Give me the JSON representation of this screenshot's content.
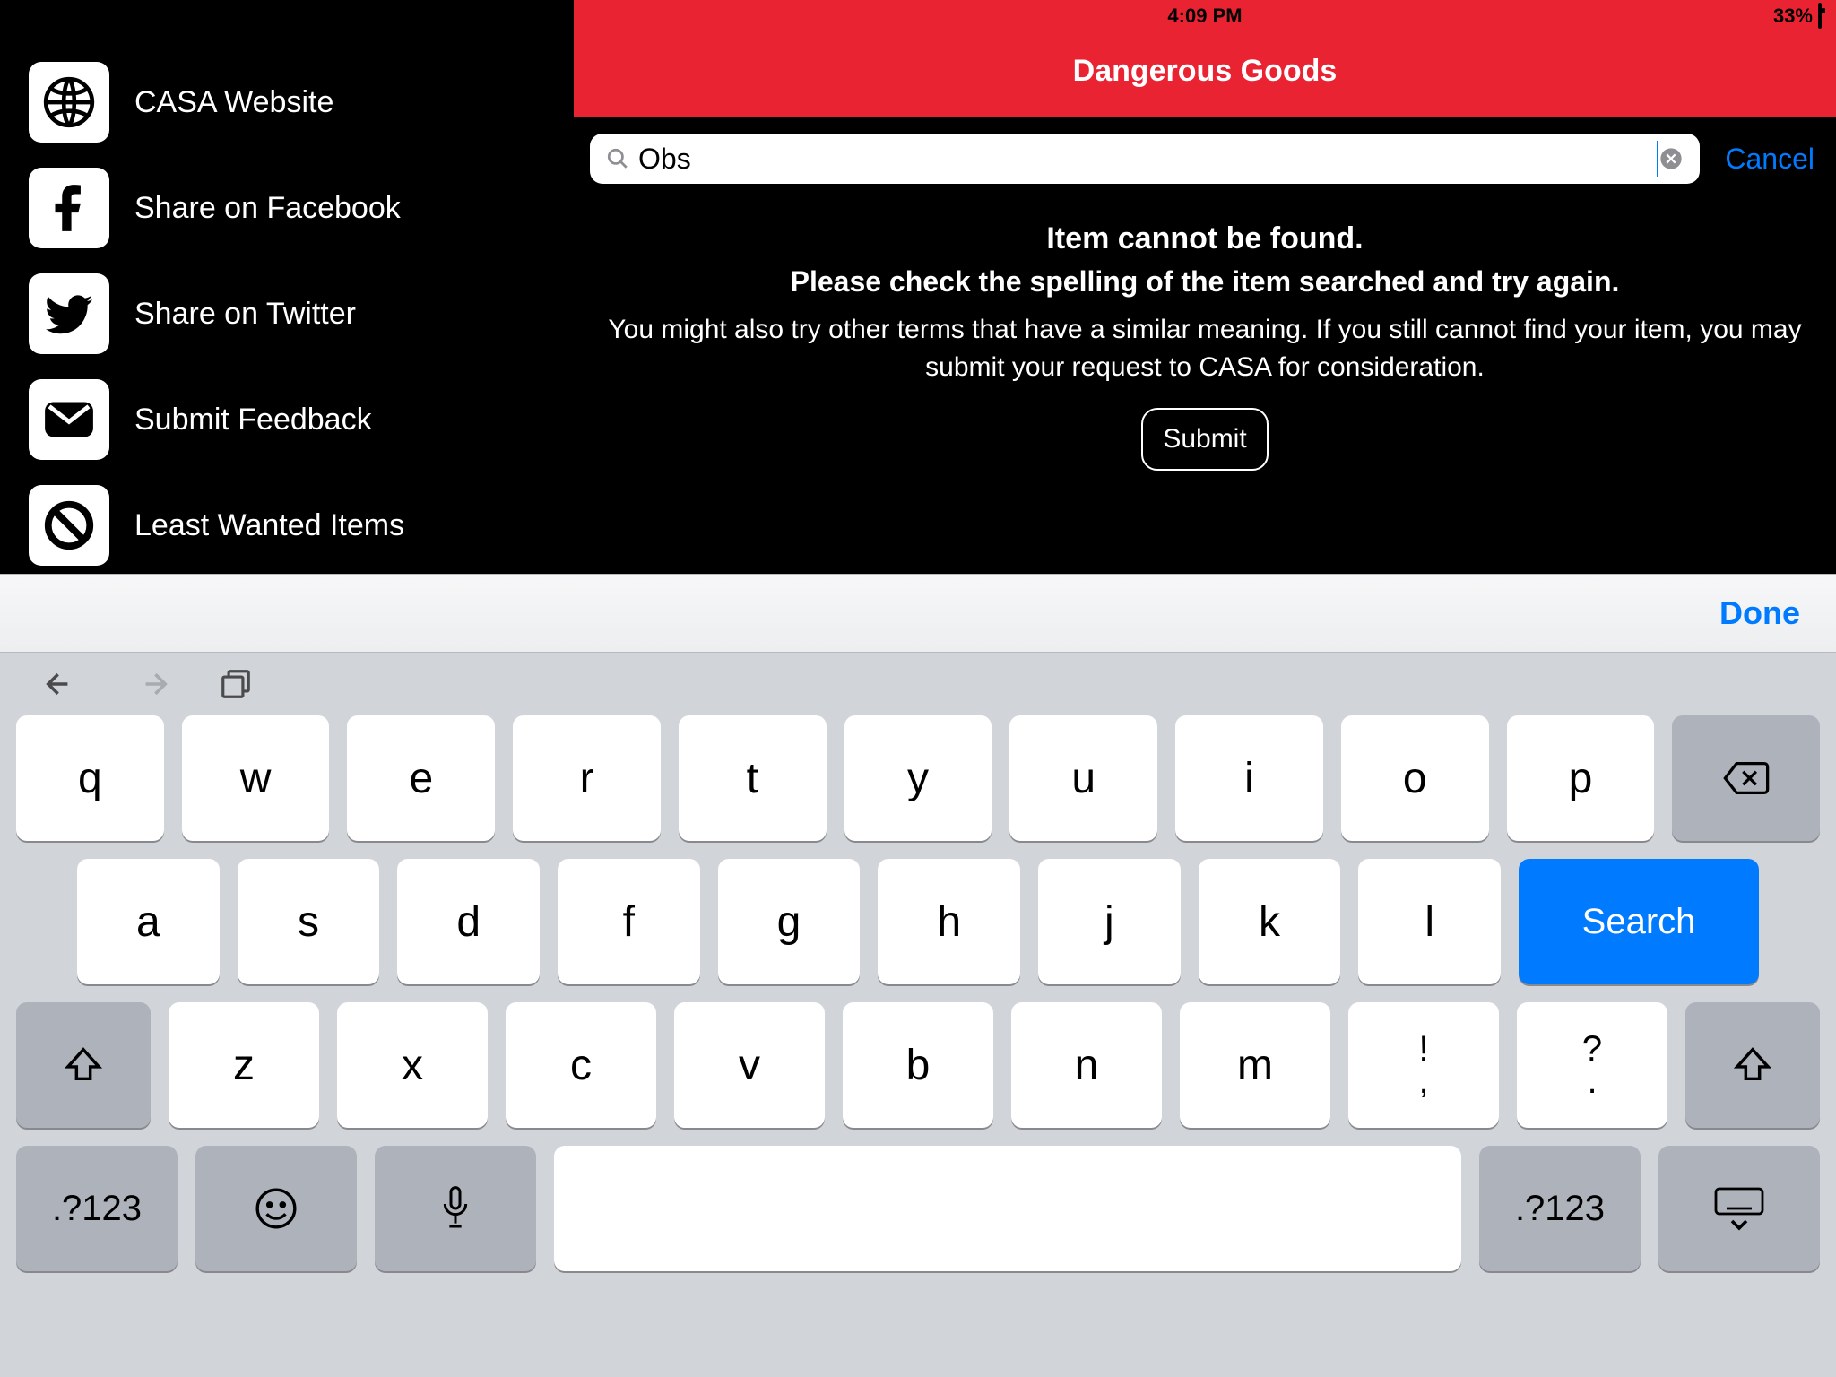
{
  "statusbar": {
    "time": "4:09 PM",
    "battery_percent": "33%",
    "battery_fill_pct": 33
  },
  "header": {
    "title": "Dangerous Goods"
  },
  "sidebar": {
    "items": [
      {
        "label": "CASA Website",
        "icon": "globe-icon"
      },
      {
        "label": "Share on Facebook",
        "icon": "facebook-icon"
      },
      {
        "label": "Share on Twitter",
        "icon": "twitter-icon"
      },
      {
        "label": "Submit Feedback",
        "icon": "mail-icon"
      },
      {
        "label": "Least Wanted Items",
        "icon": "prohibit-icon"
      }
    ]
  },
  "search": {
    "value": "Obs",
    "cancel_label": "Cancel"
  },
  "message": {
    "line1": "Item cannot be found.",
    "line2": "Please check the spelling of the item searched and try again.",
    "body": "You might also try other terms that have a similar meaning. If you still cannot find your item, you may submit your request to CASA for consideration.",
    "submit_label": "Submit"
  },
  "accessory": {
    "done_label": "Done"
  },
  "keyboard": {
    "row1": [
      "q",
      "w",
      "e",
      "r",
      "t",
      "y",
      "u",
      "i",
      "o",
      "p"
    ],
    "row2": [
      "a",
      "s",
      "d",
      "f",
      "g",
      "h",
      "j",
      "k",
      "l"
    ],
    "action_label": "Search",
    "row3": [
      "z",
      "x",
      "c",
      "v",
      "b",
      "n",
      "m"
    ],
    "row3_punct": [
      {
        "top": "!",
        "bottom": ","
      },
      {
        "top": "?",
        "bottom": "."
      }
    ],
    "mode_label": ".?123"
  }
}
